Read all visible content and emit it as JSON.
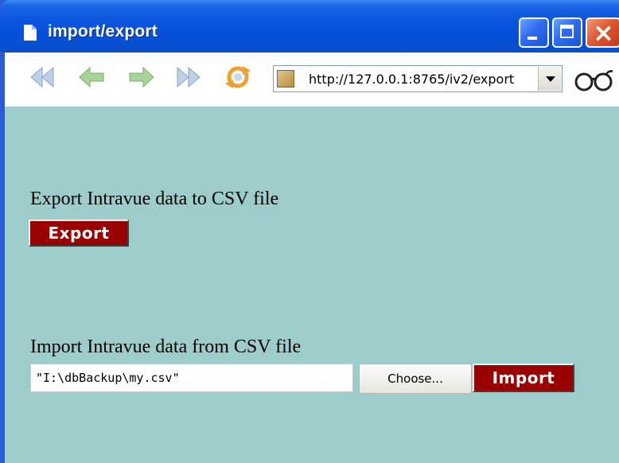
{
  "window": {
    "title": "import/export",
    "icons": {
      "page": "document-icon",
      "minimize": "minimize-icon",
      "maximize": "maximize-icon",
      "close": "close-icon"
    },
    "close_glyph": "×"
  },
  "toolbar": {
    "icons": [
      "first-icon",
      "back-icon",
      "forward-icon",
      "last-icon",
      "refresh-icon",
      "glasses-icon"
    ],
    "url": "http://127.0.0.1:8765/iv2/export"
  },
  "export": {
    "heading": "Export Intravue data to CSV file",
    "button_label": "Export"
  },
  "import": {
    "heading": "Import Intravue data from CSV file",
    "file_value": "\"I:\\dbBackup\\my.csv\"",
    "choose_label": "Choose...",
    "button_label": "Import"
  },
  "colors": {
    "titlebar": "#0a55dd",
    "content_bg": "#9dcdcb",
    "button_red": "#990000"
  }
}
